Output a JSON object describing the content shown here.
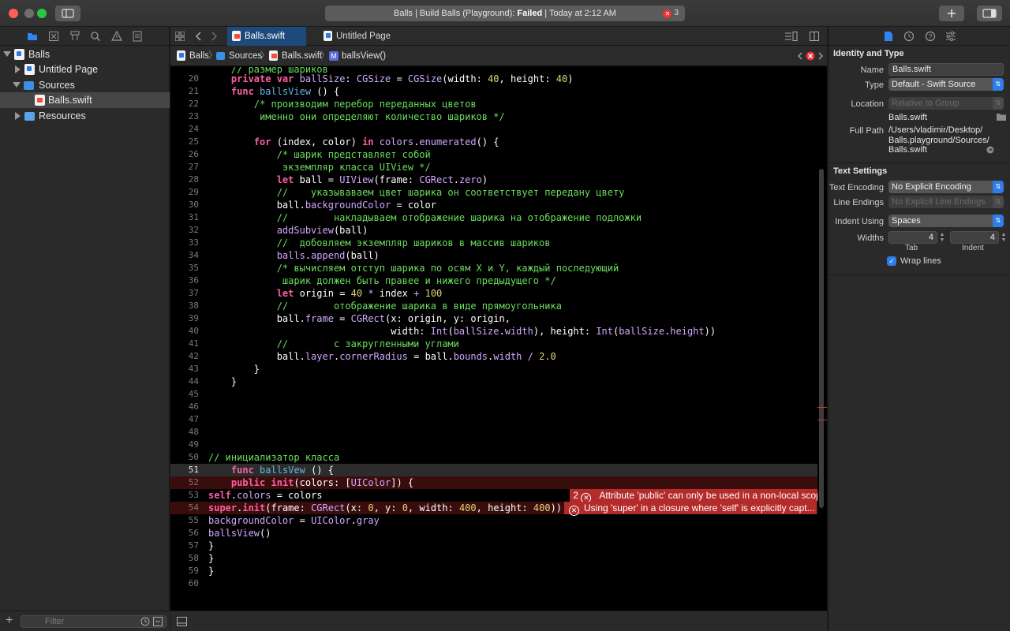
{
  "titlebar": {
    "status_prefix": "Balls | Build Balls (Playground): ",
    "status_state": "Failed",
    "status_suffix": " | Today at 2:12 AM",
    "error_count": "3",
    "error_glyph": "✕"
  },
  "navigator": {
    "tree": [
      {
        "label": "Balls"
      },
      {
        "label": "Untitled Page"
      },
      {
        "label": "Sources"
      },
      {
        "label": "Balls.swift"
      },
      {
        "label": "Resources"
      }
    ],
    "filter_placeholder": "Filter"
  },
  "editor": {
    "tabs": [
      {
        "label": "Balls.swift"
      },
      {
        "label": "Untitled Page"
      }
    ],
    "jumpbar": [
      {
        "label": "Balls"
      },
      {
        "label": "Sources"
      },
      {
        "label": "Balls.swift"
      },
      {
        "label": "ballsView()"
      }
    ],
    "jumpbar_method_badge": "M",
    "line_numbers": [
      "20",
      "21",
      "22",
      "23",
      "24",
      "25",
      "26",
      "27",
      "28",
      "29",
      "30",
      "31",
      "32",
      "33",
      "34",
      "35",
      "36",
      "37",
      "38",
      "39",
      "40",
      "41",
      "42",
      "43",
      "44",
      "45",
      "46",
      "47",
      "48",
      "49",
      "50",
      "51",
      "52",
      "53",
      "54",
      "55",
      "56",
      "57",
      "58",
      "59",
      "60"
    ],
    "errors": [
      {
        "count": "2",
        "message": "Attribute 'public' can only be used in a non-local scope"
      },
      {
        "message": "Using 'super' in a closure where 'self' is explicitly capt..."
      }
    ]
  },
  "inspector": {
    "identity_title": "Identity and Type",
    "name_label": "Name",
    "name_value": "Balls.swift",
    "type_label": "Type",
    "type_value": "Default - Swift Source",
    "location_label": "Location",
    "location_value": "Relative to Group",
    "location_file": "Balls.swift",
    "full_path_label": "Full Path",
    "full_path_1": "/Users/vladimir/Desktop/",
    "full_path_2": "Balls.playground/Sources/",
    "full_path_3": "Balls.swift",
    "text_settings_title": "Text Settings",
    "encoding_label": "Text Encoding",
    "encoding_value": "No Explicit Encoding",
    "line_endings_label": "Line Endings",
    "line_endings_value": "No Explicit Line Endings",
    "indent_using_label": "Indent Using",
    "indent_using_value": "Spaces",
    "widths_label": "Widths",
    "tab_width": "4",
    "indent_width": "4",
    "tab_caption": "Tab",
    "indent_caption": "Indent",
    "wrap_lines_label": "Wrap lines",
    "wrap_lines_checked": true
  },
  "colors": {
    "accent": "#2f86f2",
    "error": "#b42b2b",
    "keyword": "#fc5fa3",
    "comment": "#6bdd5e",
    "type": "#d0a8ff",
    "number": "#e3d678"
  },
  "icons": [
    "sidebar-toggle-icon",
    "plus-icon",
    "inspector-toggle-icon",
    "folder-icon",
    "error-icon",
    "chevron-left-icon",
    "chevron-right-icon",
    "grid-icon",
    "file-icon",
    "history-icon",
    "help-icon",
    "attributes-icon"
  ]
}
